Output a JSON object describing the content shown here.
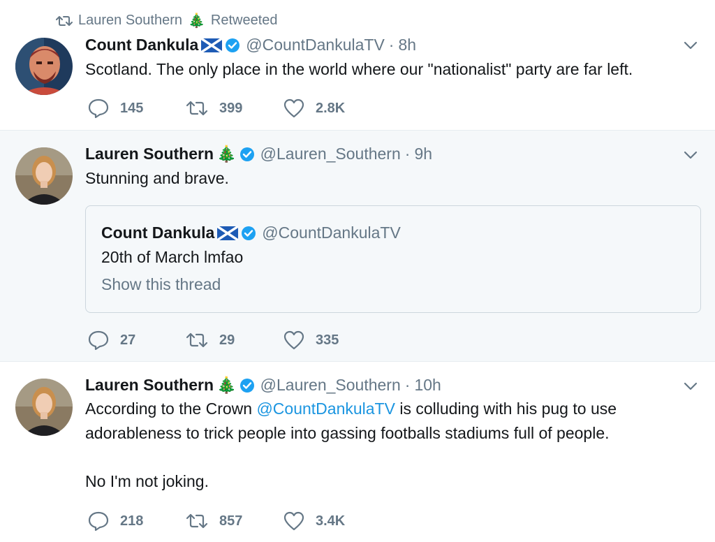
{
  "retweet_bar": {
    "user": "Lauren Southern",
    "tree": "🎄",
    "label": "Retweeted"
  },
  "tweets": [
    {
      "name": "Count Dankula",
      "handle": "@CountDankulaTV",
      "time": "8h",
      "text": "Scotland. The only place in the world where our \"nationalist\" party are far left.",
      "replies": "145",
      "retweets": "399",
      "likes": "2.8K"
    },
    {
      "name": "Lauren Southern",
      "tree": "🎄",
      "handle": "@Lauren_Southern",
      "time": "9h",
      "text": "Stunning and brave.",
      "quote": {
        "name": "Count Dankula",
        "handle": "@CountDankulaTV",
        "text": "20th of March lmfao",
        "show_thread": "Show this thread"
      },
      "replies": "27",
      "retweets": "29",
      "likes": "335"
    },
    {
      "name": "Lauren Southern",
      "tree": "🎄",
      "handle": "@Lauren_Southern",
      "time": "10h",
      "text_pre": "According to the Crown ",
      "mention": "@CountDankulaTV",
      "text_post": " is colluding with his pug to use",
      "text_line2": "adorableness to trick people into gassing footballs stadiums full of people.",
      "text_line3": "No I'm not joking.",
      "replies": "218",
      "retweets": "857",
      "likes": "3.4K"
    }
  ],
  "separator": "·",
  "colors": {
    "accent": "#1da1f2",
    "muted": "#657786",
    "text": "#14171a",
    "hover_bg": "#f5f8fa"
  }
}
